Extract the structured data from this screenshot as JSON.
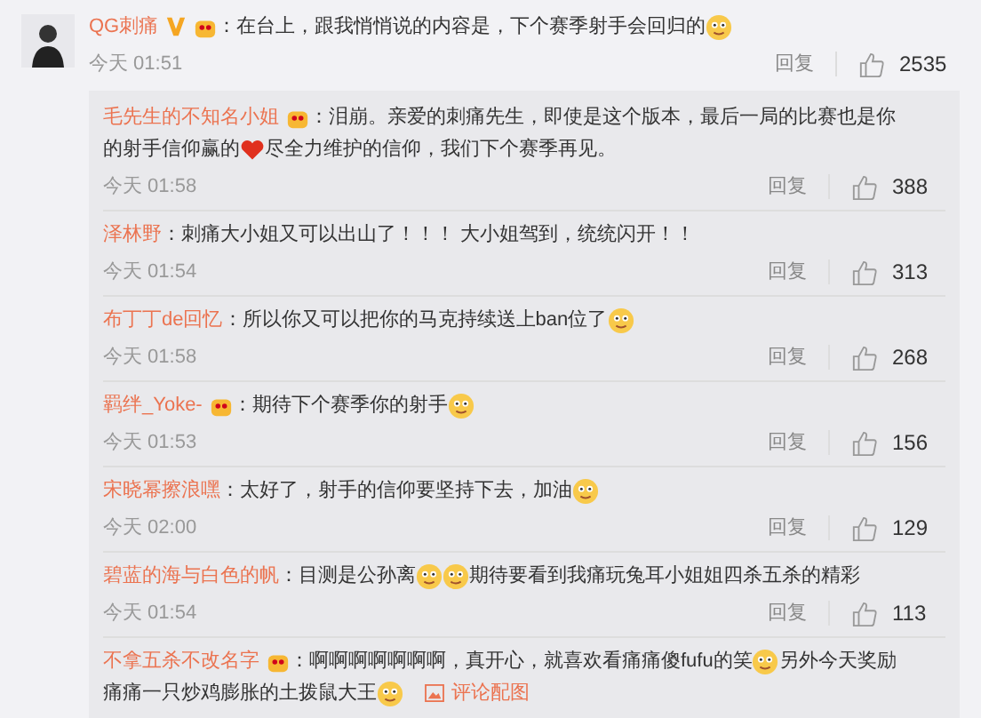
{
  "comment": {
    "author": "QG刺痛",
    "badges": [
      {
        "kind": "verified"
      },
      {
        "kind": "member"
      }
    ],
    "lines": [
      [
        {
          "kind": "text",
          "text": "：在台上，跟我悄悄说的内容是，下个赛季射手会回归的"
        },
        {
          "kind": "emoji"
        }
      ]
    ],
    "time": "今天 01:51",
    "reply_label": "回复",
    "likes": "2535"
  },
  "replies": [
    {
      "author": "毛先生的不知名小姐",
      "badges": [
        {
          "kind": "member"
        }
      ],
      "lines": [
        [
          {
            "kind": "text",
            "text": "：泪崩。亲爱的刺痛先生，即使是这个版本，最后一局的比赛也是你"
          }
        ],
        [
          {
            "kind": "text",
            "text": "的射手信仰赢的"
          },
          {
            "kind": "heart"
          },
          {
            "kind": "text",
            "text": "尽全力维护的信仰，我们下个赛季再见。"
          }
        ]
      ],
      "time": "今天 01:58",
      "reply_label": "回复",
      "likes": "388"
    },
    {
      "author": "泽林野",
      "lines": [
        [
          {
            "kind": "text",
            "text": "：刺痛大小姐又可以出山了！！！ 大小姐驾到，统统闪开！！"
          }
        ]
      ],
      "time": "今天 01:54",
      "reply_label": "回复",
      "likes": "313"
    },
    {
      "author": "布丁丁de回忆",
      "lines": [
        [
          {
            "kind": "text",
            "text": "：所以你又可以把你的马克持续送上ban位了"
          },
          {
            "kind": "emoji"
          }
        ]
      ],
      "time": "今天 01:58",
      "reply_label": "回复",
      "likes": "268"
    },
    {
      "author": "羁绊_Yoke-",
      "badges": [
        {
          "kind": "member"
        }
      ],
      "lines": [
        [
          {
            "kind": "text",
            "text": "：期待下个赛季你的射手"
          },
          {
            "kind": "emoji"
          }
        ]
      ],
      "time": "今天 01:53",
      "reply_label": "回复",
      "likes": "156"
    },
    {
      "author": "宋晓幂擦浪嘿",
      "lines": [
        [
          {
            "kind": "text",
            "text": "：太好了，射手的信仰要坚持下去，加油"
          },
          {
            "kind": "emoji"
          }
        ]
      ],
      "time": "今天 02:00",
      "reply_label": "回复",
      "likes": "129"
    },
    {
      "author": "碧蓝的海与白色的帆",
      "lines": [
        [
          {
            "kind": "text",
            "text": "：目测是公孙离"
          },
          {
            "kind": "emoji"
          },
          {
            "kind": "emoji"
          },
          {
            "kind": "text",
            "text": "期待要看到我痛玩兔耳小姐姐四杀五杀的精彩"
          }
        ]
      ],
      "time": "今天 01:54",
      "reply_label": "回复",
      "likes": "113"
    },
    {
      "author": "不拿五杀不改名字",
      "badges": [
        {
          "kind": "member"
        }
      ],
      "lines": [
        [
          {
            "kind": "text",
            "text": "：啊啊啊啊啊啊啊，真开心，就喜欢看痛痛傻fufu的笑"
          },
          {
            "kind": "emoji"
          },
          {
            "kind": "text",
            "text": "另外今天奖励"
          }
        ],
        [
          {
            "kind": "text",
            "text": "痛痛一只炒鸡膨胀的土拨鼠大王"
          },
          {
            "kind": "emoji"
          }
        ]
      ],
      "attachment": "评论配图"
    }
  ]
}
